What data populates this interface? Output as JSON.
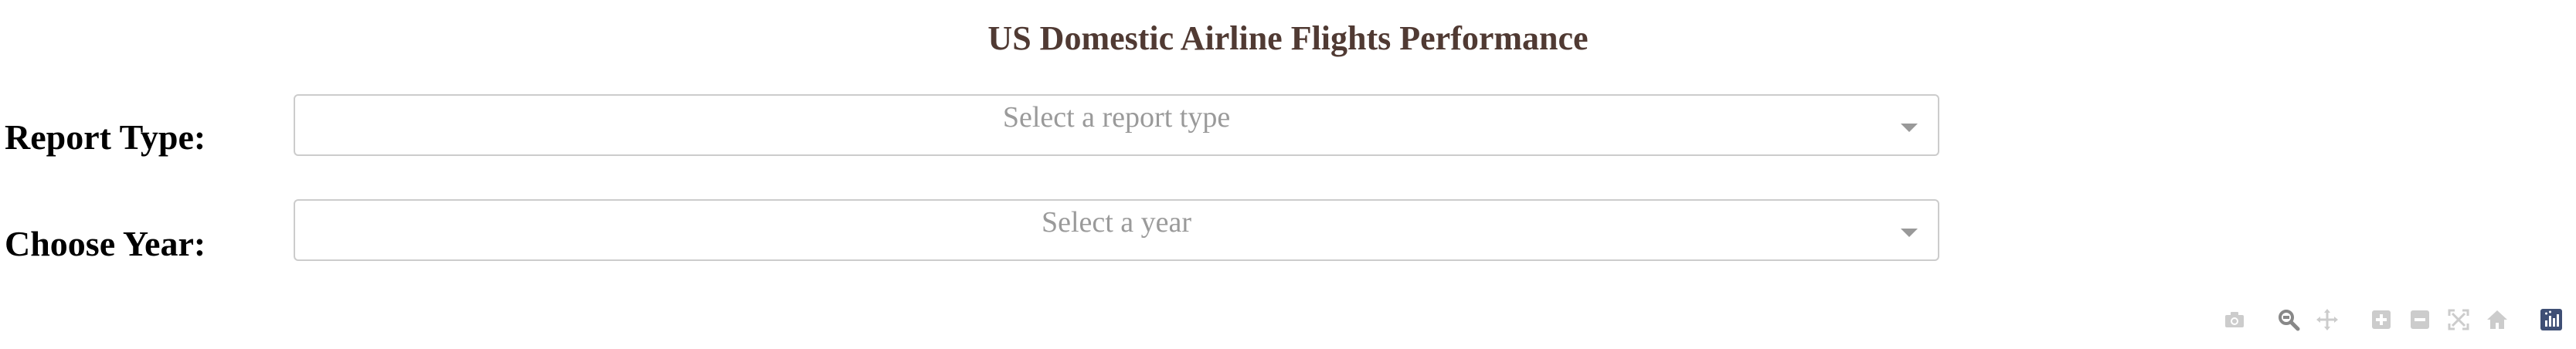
{
  "page": {
    "title": "US Domestic Airline Flights Performance"
  },
  "report_type": {
    "label": "Report Type:",
    "placeholder": "Select a report type",
    "selected_value": ""
  },
  "year": {
    "label": "Choose Year:",
    "placeholder": "Select a year",
    "selected_value": ""
  },
  "modebar": {
    "buttons": [
      {
        "icon": "camera-icon",
        "color": "#cccccc"
      },
      {
        "icon": "zoom-icon",
        "color": "#888888",
        "active": true
      },
      {
        "icon": "pan-icon",
        "color": "#cccccc"
      },
      {
        "icon": "zoom-in-icon",
        "color": "#cccccc"
      },
      {
        "icon": "zoom-out-icon",
        "color": "#cccccc"
      },
      {
        "icon": "autoscale-icon",
        "color": "#cccccc"
      },
      {
        "icon": "reset-axes-icon",
        "color": "#cccccc"
      },
      {
        "icon": "plotly-logo-icon",
        "color": "#3f4f75"
      }
    ]
  },
  "colors": {
    "title": "#503a33",
    "placeholder": "#9a9a9a",
    "dropdown_border": "#cccccc",
    "modebar_inactive": "#cccccc",
    "modebar_active": "#888888",
    "plotly_logo": "#3f4f75"
  }
}
